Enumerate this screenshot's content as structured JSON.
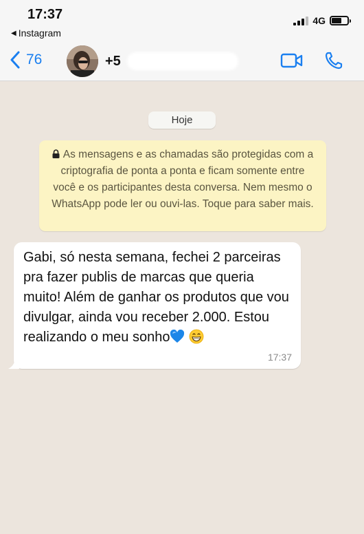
{
  "status_bar": {
    "time": "17:37",
    "back_app": "Instagram",
    "network": "4G"
  },
  "header": {
    "back_count": "76",
    "contact_name": "+5"
  },
  "chat": {
    "date_label": "Hoje",
    "encryption_notice": "As mensagens e as chamadas são protegidas com a criptografia de ponta a ponta e ficam somente entre você e os participantes desta conversa. Nem mesmo o WhatsApp pode ler ou ouvi-las. Toque para saber mais.",
    "message": {
      "text": "Gabi, só nesta semana, fechei 2 parceiras pra fazer publis de marcas que queria muito! Além de ganhar os produtos que vou divulgar, ainda vou receber 2.000. Estou realizando o meu sonho",
      "time": "17:37"
    }
  },
  "colors": {
    "accent": "#1a7ff0",
    "chat_background": "#ece5dd",
    "notice_background": "#fcf4c4",
    "bubble_background": "#ffffff"
  },
  "icons": [
    "back-triangle-icon",
    "signal-icon",
    "battery-icon",
    "chevron-left-icon",
    "video-call-icon",
    "phone-icon",
    "lock-icon",
    "blue-heart-emoji-icon",
    "grinning-emoji-icon"
  ]
}
